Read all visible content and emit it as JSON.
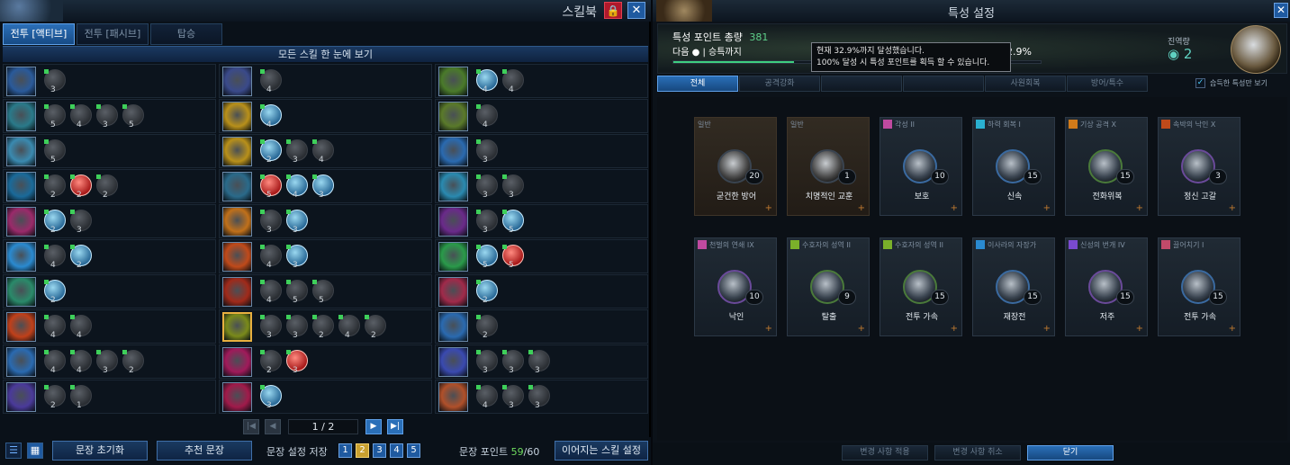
{
  "skillbook": {
    "title": "스킬북",
    "tabs": [
      {
        "label": "전투 [액티브]",
        "active": true
      },
      {
        "label": "전투 [패시브]",
        "active": false
      },
      {
        "label": "탑승",
        "active": false
      }
    ],
    "subheader": "모든 스킬 한 눈에 보기",
    "rows": [
      [
        {
          "color": "#2a5a9a",
          "glyphs": [
            {
              "c": "3",
              "t": "n"
            }
          ]
        },
        {
          "color": "#3a4a8a",
          "glyphs": [
            {
              "c": "4",
              "t": "n"
            }
          ]
        },
        {
          "color": "#4a7a2a",
          "glyphs": [
            {
              "c": "4",
              "t": "on"
            },
            {
              "c": "4",
              "t": "n"
            }
          ]
        }
      ],
      [
        {
          "color": "#2a7a8a",
          "glyphs": [
            {
              "c": "5",
              "t": "n"
            },
            {
              "c": "4",
              "t": "n"
            },
            {
              "c": "3",
              "t": "n"
            },
            {
              "c": "5",
              "t": "n"
            }
          ]
        },
        {
          "color": "#b8901a",
          "glyphs": [
            {
              "c": "4",
              "t": "on"
            }
          ]
        },
        {
          "color": "#5a7a2a",
          "glyphs": [
            {
              "c": "4",
              "t": "n"
            }
          ]
        }
      ],
      [
        {
          "color": "#3a8ab0",
          "glyphs": [
            {
              "c": "5",
              "t": "n"
            }
          ]
        },
        {
          "color": "#b8901a",
          "glyphs": [
            {
              "c": "2",
              "t": "on"
            },
            {
              "c": "3",
              "t": "n"
            },
            {
              "c": "4",
              "t": "n"
            }
          ]
        },
        {
          "color": "#2a6ab0",
          "glyphs": [
            {
              "c": "3",
              "t": "n"
            }
          ]
        }
      ],
      [
        {
          "color": "#1a6a9a",
          "glyphs": [
            {
              "c": "2",
              "t": "n"
            },
            {
              "c": "2",
              "t": "red"
            },
            {
              "c": "2",
              "t": "n"
            }
          ]
        },
        {
          "color": "#2a6a8a",
          "glyphs": [
            {
              "c": "5",
              "t": "red"
            },
            {
              "c": "4",
              "t": "on"
            },
            {
              "c": "3",
              "t": "on"
            }
          ]
        },
        {
          "color": "#2a8ab0",
          "glyphs": [
            {
              "c": "3",
              "t": "n"
            },
            {
              "c": "3",
              "t": "n"
            }
          ]
        }
      ],
      [
        {
          "color": "#9a2a6a",
          "glyphs": [
            {
              "c": "2",
              "t": "on"
            },
            {
              "c": "3",
              "t": "n"
            }
          ]
        },
        {
          "color": "#c0701a",
          "glyphs": [
            {
              "c": "3",
              "t": "n"
            },
            {
              "c": "3",
              "t": "on"
            }
          ]
        },
        {
          "color": "#6a2a8a",
          "glyphs": [
            {
              "c": "3",
              "t": "n"
            },
            {
              "c": "5",
              "t": "on"
            }
          ]
        }
      ],
      [
        {
          "color": "#2a8ad0",
          "glyphs": [
            {
              "c": "4",
              "t": "n"
            },
            {
              "c": "2",
              "t": "on"
            }
          ]
        },
        {
          "color": "#c04a1a",
          "glyphs": [
            {
              "c": "4",
              "t": "n"
            },
            {
              "c": "3",
              "t": "on"
            }
          ]
        },
        {
          "color": "#2a9a4a",
          "glyphs": [
            {
              "c": "5",
              "t": "on"
            },
            {
              "c": "5",
              "t": "red"
            }
          ]
        }
      ],
      [
        {
          "color": "#2a8a6a",
          "glyphs": [
            {
              "c": "2",
              "t": "on"
            }
          ]
        },
        {
          "color": "#a02a1a",
          "glyphs": [
            {
              "c": "4",
              "t": "n"
            },
            {
              "c": "5",
              "t": "n"
            },
            {
              "c": "5",
              "t": "n"
            }
          ]
        },
        {
          "color": "#a02a4a",
          "glyphs": [
            {
              "c": "2",
              "t": "on"
            }
          ]
        }
      ],
      [
        {
          "color": "#c0401a",
          "glyphs": [
            {
              "c": "4",
              "t": "n"
            },
            {
              "c": "4",
              "t": "n"
            }
          ]
        },
        {
          "color": "#7a8a1a",
          "selected": true,
          "glyphs": [
            {
              "c": "3",
              "t": "n"
            },
            {
              "c": "3",
              "t": "n"
            },
            {
              "c": "2",
              "t": "n"
            },
            {
              "c": "4",
              "t": "n"
            },
            {
              "c": "2",
              "t": "n"
            }
          ]
        },
        {
          "color": "#2a6ab0",
          "glyphs": [
            {
              "c": "2",
              "t": "n"
            }
          ]
        }
      ],
      [
        {
          "color": "#2a6ab0",
          "glyphs": [
            {
              "c": "4",
              "t": "n"
            },
            {
              "c": "4",
              "t": "n"
            },
            {
              "c": "3",
              "t": "n"
            },
            {
              "c": "2",
              "t": "n"
            }
          ]
        },
        {
          "color": "#a01a5a",
          "glyphs": [
            {
              "c": "2",
              "t": "n"
            },
            {
              "c": "3",
              "t": "red"
            }
          ]
        },
        {
          "color": "#3a4ab0",
          "glyphs": [
            {
              "c": "3",
              "t": "n"
            },
            {
              "c": "3",
              "t": "n"
            },
            {
              "c": "3",
              "t": "n"
            }
          ]
        }
      ],
      [
        {
          "color": "#4a3a9a",
          "glyphs": [
            {
              "c": "2",
              "t": "n"
            },
            {
              "c": "1",
              "t": "n"
            }
          ]
        },
        {
          "color": "#a01a4a",
          "glyphs": [
            {
              "c": "3",
              "t": "on"
            }
          ]
        },
        {
          "color": "#b0502a",
          "glyphs": [
            {
              "c": "4",
              "t": "n"
            },
            {
              "c": "3",
              "t": "n"
            },
            {
              "c": "3",
              "t": "n"
            }
          ]
        }
      ]
    ],
    "pager": {
      "page": "1 / 2"
    },
    "bottom": {
      "reset_label": "문장 초기화",
      "recommend_label": "추천 문장",
      "save_label": "문장 설정 저장",
      "slots": [
        "1",
        "2",
        "3",
        "4",
        "5"
      ],
      "active_slot": 1,
      "points_label": "문장 포인트",
      "points_current": "59",
      "points_total": "/60",
      "chain_label": "이어지는 스킬 설정"
    }
  },
  "traits": {
    "title": "특성 설정",
    "total_label": "특성 포인트 총량",
    "total_value": "381",
    "next_label": "다음 ● | 승특까지",
    "progress": 0.329,
    "progress_text": "32.9%",
    "tooltip_line1": "현재 32.9%까지 달성했습니다.",
    "tooltip_line2": "100% 달성 시 특성 포인트를 획득 할 수 있습니다.",
    "chain_label": "진역량",
    "chain_value": "2",
    "tabs": [
      {
        "label": "전체",
        "active": true
      },
      {
        "label": "공격강화",
        "active": false
      },
      {
        "label": "",
        "active": false
      },
      {
        "label": "",
        "active": false
      },
      {
        "label": "사원회복",
        "active": false
      },
      {
        "label": "방어/특수",
        "active": false
      }
    ],
    "learned_only_label": "습득한 특성만 보기",
    "cards": [
      {
        "tag": "일반",
        "name": "굳건한 방어",
        "level": "20",
        "brown": true,
        "ring": "n",
        "tagcolor": ""
      },
      {
        "tag": "일반",
        "name": "치명적인 교훈",
        "level": "1",
        "brown": true,
        "ring": "n",
        "tagcolor": ""
      },
      {
        "tag": "각성 II",
        "name": "보호",
        "level": "10",
        "brown": false,
        "ring": "b",
        "tagcolor": "#c04aa0"
      },
      {
        "tag": "하력 회복 I",
        "name": "신속",
        "level": "15",
        "brown": false,
        "ring": "b",
        "tagcolor": "#2ab0d0"
      },
      {
        "tag": "기상 공격 X",
        "name": "전화위복",
        "level": "15",
        "brown": false,
        "ring": "g",
        "tagcolor": "#d07a1a"
      },
      {
        "tag": "속박의 낙인 X",
        "name": "정신 고갈",
        "level": "3",
        "brown": false,
        "ring": "p",
        "tagcolor": "#c04a1a"
      },
      {
        "tag": "천벌의 연쇄 IX",
        "name": "낙인",
        "level": "10",
        "brown": false,
        "ring": "p",
        "tagcolor": "#c04aa0"
      },
      {
        "tag": "수호자의 성역 II",
        "name": "탈출",
        "level": "9",
        "brown": false,
        "ring": "g",
        "tagcolor": "#7ab02a"
      },
      {
        "tag": "수호자의 성역 II",
        "name": "전투 가속",
        "level": "15",
        "brown": false,
        "ring": "g",
        "tagcolor": "#7ab02a"
      },
      {
        "tag": "이사라의 자장가",
        "name": "재장전",
        "level": "15",
        "brown": false,
        "ring": "b",
        "tagcolor": "#2a8ad0"
      },
      {
        "tag": "신성의 번개 IV",
        "name": "저주",
        "level": "15",
        "brown": false,
        "ring": "p",
        "tagcolor": "#7a4ad0"
      },
      {
        "tag": "끌어치기 I",
        "name": "전투 가속",
        "level": "15",
        "brown": false,
        "ring": "b",
        "tagcolor": "#c04a6a"
      }
    ],
    "bottom": {
      "apply_label": "변경 사항 적용",
      "cancel_label": "변경 사항 취소",
      "close_label": "닫기"
    }
  }
}
